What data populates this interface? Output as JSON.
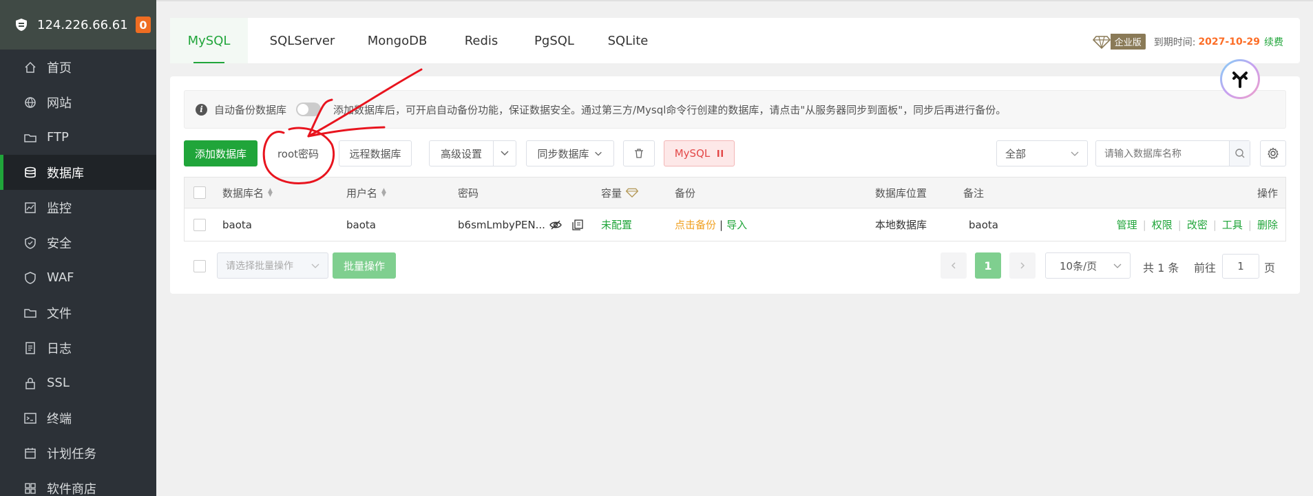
{
  "server": {
    "ip": "124.226.66.61",
    "badge": "0"
  },
  "sidebar": {
    "items": [
      {
        "label": "首页",
        "icon": "home-icon"
      },
      {
        "label": "网站",
        "icon": "globe-icon"
      },
      {
        "label": "FTP",
        "icon": "ftp-icon"
      },
      {
        "label": "数据库",
        "icon": "database-icon",
        "active": true
      },
      {
        "label": "监控",
        "icon": "monitor-icon"
      },
      {
        "label": "安全",
        "icon": "shield-icon"
      },
      {
        "label": "WAF",
        "icon": "waf-icon"
      },
      {
        "label": "文件",
        "icon": "folder-icon"
      },
      {
        "label": "日志",
        "icon": "log-icon"
      },
      {
        "label": "SSL",
        "icon": "ssl-icon"
      },
      {
        "label": "终端",
        "icon": "terminal-icon"
      },
      {
        "label": "计划任务",
        "icon": "calendar-icon"
      },
      {
        "label": "软件商店",
        "icon": "store-icon"
      }
    ]
  },
  "tabs": [
    "MySQL",
    "SQLServer",
    "MongoDB",
    "Redis",
    "PgSQL",
    "SQLite"
  ],
  "edition": {
    "label": "企业版",
    "expire_label": "到期时间:",
    "expire_date": "2027-10-29",
    "renew": "续费"
  },
  "notice": {
    "toggle_label": "自动备份数据库",
    "text": "添加数据库后，可开启自动备份功能，保证数据安全。通过第三方/Mysql命令行创建的数据库，请点击\"从服务器同步到面板\"，同步后再进行备份。"
  },
  "toolbar": {
    "add": "添加数据库",
    "root_password": "root密码",
    "remote": "远程数据库",
    "advanced": "高级设置",
    "sync": "同步数据库",
    "mysql_status": "MySQL",
    "filter_value": "全部",
    "search_placeholder": "请输入数据库名称"
  },
  "table": {
    "headers": [
      "数据库名",
      "用户名",
      "密码",
      "容量",
      "备份",
      "数据库位置",
      "备注",
      "操作"
    ],
    "rows": [
      {
        "name": "baota",
        "user": "baota",
        "password": "b6smLmbyPEN...",
        "capacity": "未配置",
        "backup_link": "点击备份",
        "import_link": "导入",
        "location": "本地数据库",
        "note": "baota",
        "actions": [
          "管理",
          "权限",
          "改密",
          "工具",
          "删除"
        ]
      }
    ]
  },
  "footer": {
    "batch_placeholder": "请选择批量操作",
    "batch_button": "批量操作",
    "current_page": "1",
    "page_size": "10条/页",
    "total": "共 1 条",
    "goto_label": "前往",
    "goto_value": "1",
    "page_unit": "页"
  },
  "colors": {
    "accent": "#20a53a",
    "sidebar": "#2c3137",
    "annotation": "#e8141e"
  }
}
